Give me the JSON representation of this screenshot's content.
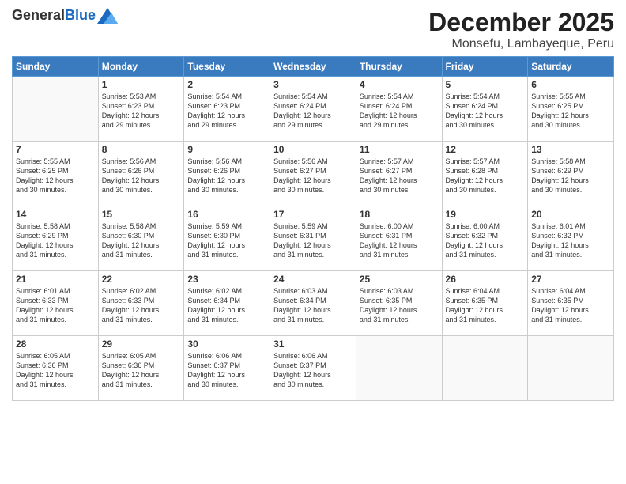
{
  "header": {
    "logo_general": "General",
    "logo_blue": "Blue",
    "month_title": "December 2025",
    "subtitle": "Monsefu, Lambayeque, Peru"
  },
  "days_of_week": [
    "Sunday",
    "Monday",
    "Tuesday",
    "Wednesday",
    "Thursday",
    "Friday",
    "Saturday"
  ],
  "weeks": [
    [
      {
        "day": "",
        "info": ""
      },
      {
        "day": "1",
        "info": "Sunrise: 5:53 AM\nSunset: 6:23 PM\nDaylight: 12 hours\nand 29 minutes."
      },
      {
        "day": "2",
        "info": "Sunrise: 5:54 AM\nSunset: 6:23 PM\nDaylight: 12 hours\nand 29 minutes."
      },
      {
        "day": "3",
        "info": "Sunrise: 5:54 AM\nSunset: 6:24 PM\nDaylight: 12 hours\nand 29 minutes."
      },
      {
        "day": "4",
        "info": "Sunrise: 5:54 AM\nSunset: 6:24 PM\nDaylight: 12 hours\nand 29 minutes."
      },
      {
        "day": "5",
        "info": "Sunrise: 5:54 AM\nSunset: 6:24 PM\nDaylight: 12 hours\nand 30 minutes."
      },
      {
        "day": "6",
        "info": "Sunrise: 5:55 AM\nSunset: 6:25 PM\nDaylight: 12 hours\nand 30 minutes."
      }
    ],
    [
      {
        "day": "7",
        "info": "Sunrise: 5:55 AM\nSunset: 6:25 PM\nDaylight: 12 hours\nand 30 minutes."
      },
      {
        "day": "8",
        "info": "Sunrise: 5:56 AM\nSunset: 6:26 PM\nDaylight: 12 hours\nand 30 minutes."
      },
      {
        "day": "9",
        "info": "Sunrise: 5:56 AM\nSunset: 6:26 PM\nDaylight: 12 hours\nand 30 minutes."
      },
      {
        "day": "10",
        "info": "Sunrise: 5:56 AM\nSunset: 6:27 PM\nDaylight: 12 hours\nand 30 minutes."
      },
      {
        "day": "11",
        "info": "Sunrise: 5:57 AM\nSunset: 6:27 PM\nDaylight: 12 hours\nand 30 minutes."
      },
      {
        "day": "12",
        "info": "Sunrise: 5:57 AM\nSunset: 6:28 PM\nDaylight: 12 hours\nand 30 minutes."
      },
      {
        "day": "13",
        "info": "Sunrise: 5:58 AM\nSunset: 6:29 PM\nDaylight: 12 hours\nand 30 minutes."
      }
    ],
    [
      {
        "day": "14",
        "info": "Sunrise: 5:58 AM\nSunset: 6:29 PM\nDaylight: 12 hours\nand 31 minutes."
      },
      {
        "day": "15",
        "info": "Sunrise: 5:58 AM\nSunset: 6:30 PM\nDaylight: 12 hours\nand 31 minutes."
      },
      {
        "day": "16",
        "info": "Sunrise: 5:59 AM\nSunset: 6:30 PM\nDaylight: 12 hours\nand 31 minutes."
      },
      {
        "day": "17",
        "info": "Sunrise: 5:59 AM\nSunset: 6:31 PM\nDaylight: 12 hours\nand 31 minutes."
      },
      {
        "day": "18",
        "info": "Sunrise: 6:00 AM\nSunset: 6:31 PM\nDaylight: 12 hours\nand 31 minutes."
      },
      {
        "day": "19",
        "info": "Sunrise: 6:00 AM\nSunset: 6:32 PM\nDaylight: 12 hours\nand 31 minutes."
      },
      {
        "day": "20",
        "info": "Sunrise: 6:01 AM\nSunset: 6:32 PM\nDaylight: 12 hours\nand 31 minutes."
      }
    ],
    [
      {
        "day": "21",
        "info": "Sunrise: 6:01 AM\nSunset: 6:33 PM\nDaylight: 12 hours\nand 31 minutes."
      },
      {
        "day": "22",
        "info": "Sunrise: 6:02 AM\nSunset: 6:33 PM\nDaylight: 12 hours\nand 31 minutes."
      },
      {
        "day": "23",
        "info": "Sunrise: 6:02 AM\nSunset: 6:34 PM\nDaylight: 12 hours\nand 31 minutes."
      },
      {
        "day": "24",
        "info": "Sunrise: 6:03 AM\nSunset: 6:34 PM\nDaylight: 12 hours\nand 31 minutes."
      },
      {
        "day": "25",
        "info": "Sunrise: 6:03 AM\nSunset: 6:35 PM\nDaylight: 12 hours\nand 31 minutes."
      },
      {
        "day": "26",
        "info": "Sunrise: 6:04 AM\nSunset: 6:35 PM\nDaylight: 12 hours\nand 31 minutes."
      },
      {
        "day": "27",
        "info": "Sunrise: 6:04 AM\nSunset: 6:35 PM\nDaylight: 12 hours\nand 31 minutes."
      }
    ],
    [
      {
        "day": "28",
        "info": "Sunrise: 6:05 AM\nSunset: 6:36 PM\nDaylight: 12 hours\nand 31 minutes."
      },
      {
        "day": "29",
        "info": "Sunrise: 6:05 AM\nSunset: 6:36 PM\nDaylight: 12 hours\nand 31 minutes."
      },
      {
        "day": "30",
        "info": "Sunrise: 6:06 AM\nSunset: 6:37 PM\nDaylight: 12 hours\nand 30 minutes."
      },
      {
        "day": "31",
        "info": "Sunrise: 6:06 AM\nSunset: 6:37 PM\nDaylight: 12 hours\nand 30 minutes."
      },
      {
        "day": "",
        "info": ""
      },
      {
        "day": "",
        "info": ""
      },
      {
        "day": "",
        "info": ""
      }
    ]
  ]
}
